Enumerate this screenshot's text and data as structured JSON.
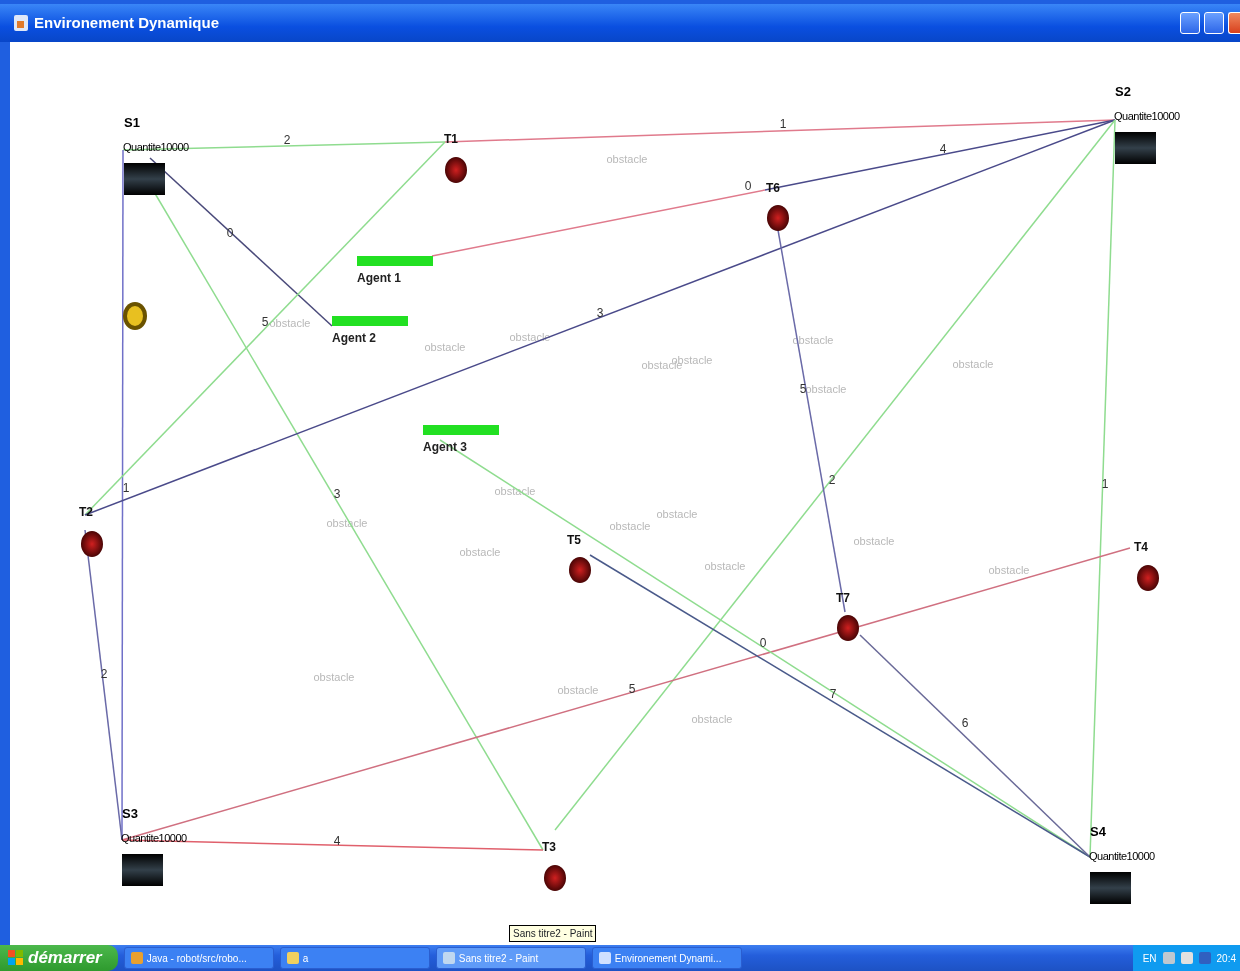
{
  "window": {
    "title": "Environement Dynamique"
  },
  "nodes": [
    {
      "kind": "source",
      "label": "S1",
      "quantity": "Quantite10000"
    },
    {
      "kind": "source",
      "label": "S2",
      "quantity": "Quantite10000"
    },
    {
      "kind": "source",
      "label": "S3",
      "quantity": "Quantite10000"
    },
    {
      "kind": "source",
      "label": "S4",
      "quantity": "Quantite10000"
    },
    {
      "kind": "target",
      "label": "T1"
    },
    {
      "kind": "target",
      "label": "T2"
    },
    {
      "kind": "target",
      "label": "T3"
    },
    {
      "kind": "target",
      "label": "T4"
    },
    {
      "kind": "target",
      "label": "T5"
    },
    {
      "kind": "target",
      "label": "T6"
    },
    {
      "kind": "target",
      "label": "T7"
    },
    {
      "kind": "agent",
      "label": "Agent 1"
    },
    {
      "kind": "agent",
      "label": "Agent 2"
    },
    {
      "kind": "agent",
      "label": "Agent 3"
    },
    {
      "kind": "coin"
    }
  ],
  "edges": [
    {
      "weight": "2",
      "color": "#8fdc8f"
    },
    {
      "weight": "1",
      "color": "#e07a8c"
    },
    {
      "weight": "0",
      "color": "#4a4a7a"
    },
    {
      "weight": "1",
      "color": "#7070c8"
    },
    {
      "weight": "5",
      "color": "#8fdc8f"
    },
    {
      "weight": "3",
      "color": "#8fdc8f"
    },
    {
      "weight": "3",
      "color": "#4a4a8a"
    },
    {
      "weight": "0",
      "color": "#e07a8c"
    },
    {
      "weight": "4",
      "color": "#4a4a8a"
    },
    {
      "weight": "2",
      "color": "#8fdc8f"
    },
    {
      "weight": "1",
      "color": "#8fdc8f"
    },
    {
      "weight": "5",
      "color": "#6a6aa8"
    },
    {
      "weight": "2",
      "color": "#6a6aa8"
    },
    {
      "weight": "5",
      "color": "#d07080"
    },
    {
      "weight": "4",
      "color": "#e0606c"
    },
    {
      "weight": "0",
      "color": "#8fdc8f"
    },
    {
      "weight": "7",
      "color": "#4a5a8a"
    },
    {
      "weight": "6",
      "color": "#6a6a98"
    }
  ],
  "obstacles": [
    "obstacle",
    "obstacle",
    "obstacle",
    "obstacle",
    "obstacle",
    "obstacle",
    "obstacle",
    "obstacle",
    "obstacle",
    "obstacle",
    "obstacle",
    "obstacle",
    "obstacle",
    "obstacle",
    "obstacle",
    "obstacle",
    "obstacle",
    "obstacle",
    "obstacle",
    "obstacle"
  ],
  "tooltip": "Sans titre2 - Paint",
  "taskbar": {
    "start": "démarrer",
    "tasks": [
      {
        "label": "Java - robot/src/robo...",
        "selected": false
      },
      {
        "label": "a",
        "selected": false
      },
      {
        "label": "Sans titre2 - Paint",
        "selected": true
      },
      {
        "label": "Environement Dynami...",
        "selected": false
      }
    ],
    "tray": [
      "EN",
      "20:4"
    ]
  }
}
